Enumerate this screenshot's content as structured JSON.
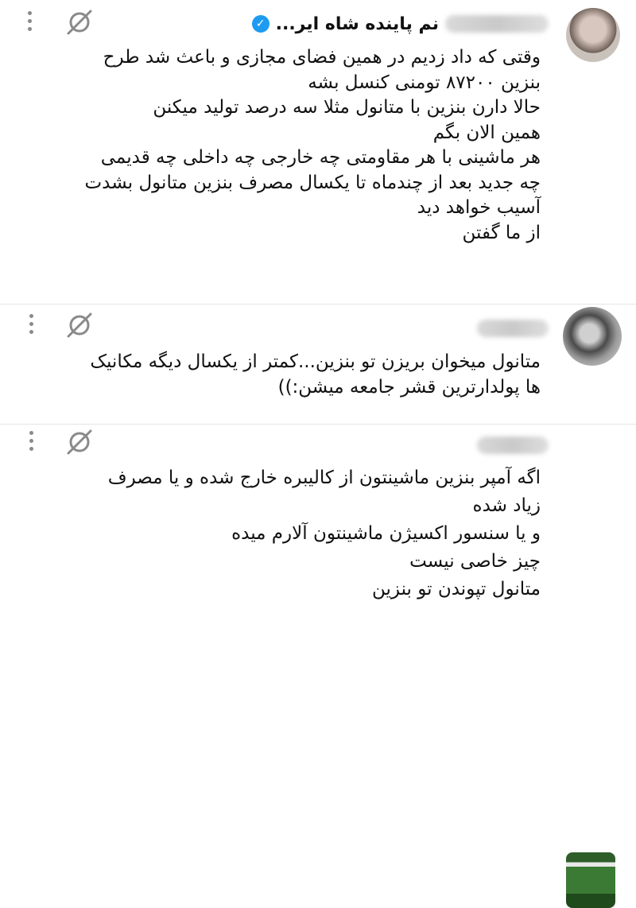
{
  "posts": [
    {
      "username": "نم پاینده شاه ایر...",
      "verified": true,
      "lines": [
        "وقتی که داد زدیم در همین فضای مجازی و باعث شد طرح",
        "بنزین ۸۷۲۰۰ تومنی کنسل بشه",
        "حالا دارن بنزین با متانول مثلا سه درصد تولید میکنن",
        "همین الان بگم",
        "هر ماشینی با هر مقاومتی چه خارجی چه داخلی چه قدیمی",
        "چه جدید بعد از چندماه تا یکسال مصرف بنزین متانول بشدت",
        "آسیب خواهد دید",
        "از ما گفتن"
      ]
    },
    {
      "lines": [
        "متانول میخوان بریزن تو بنزین...کمتر از یکسال دیگه مکانیک",
        "ها پولدارترین قشر جامعه میشن:))"
      ]
    },
    {
      "lines": [
        "اگه آمپر بنزین ماشینتون از کالیبره خارج شده و یا مصرف",
        "زیاد شده",
        "و یا سنسور اکسیژن ماشینتون آلارم میده",
        "چیز خاصی نیست",
        "متانول تپوندن تو بنزین"
      ]
    }
  ],
  "icons": {
    "more": "more-icon",
    "grok": "grok-icon",
    "verified": "verified-badge-icon"
  },
  "colors": {
    "verified": "#1d9bf0",
    "icon_gray": "#8a8a8a",
    "text": "#111111"
  }
}
